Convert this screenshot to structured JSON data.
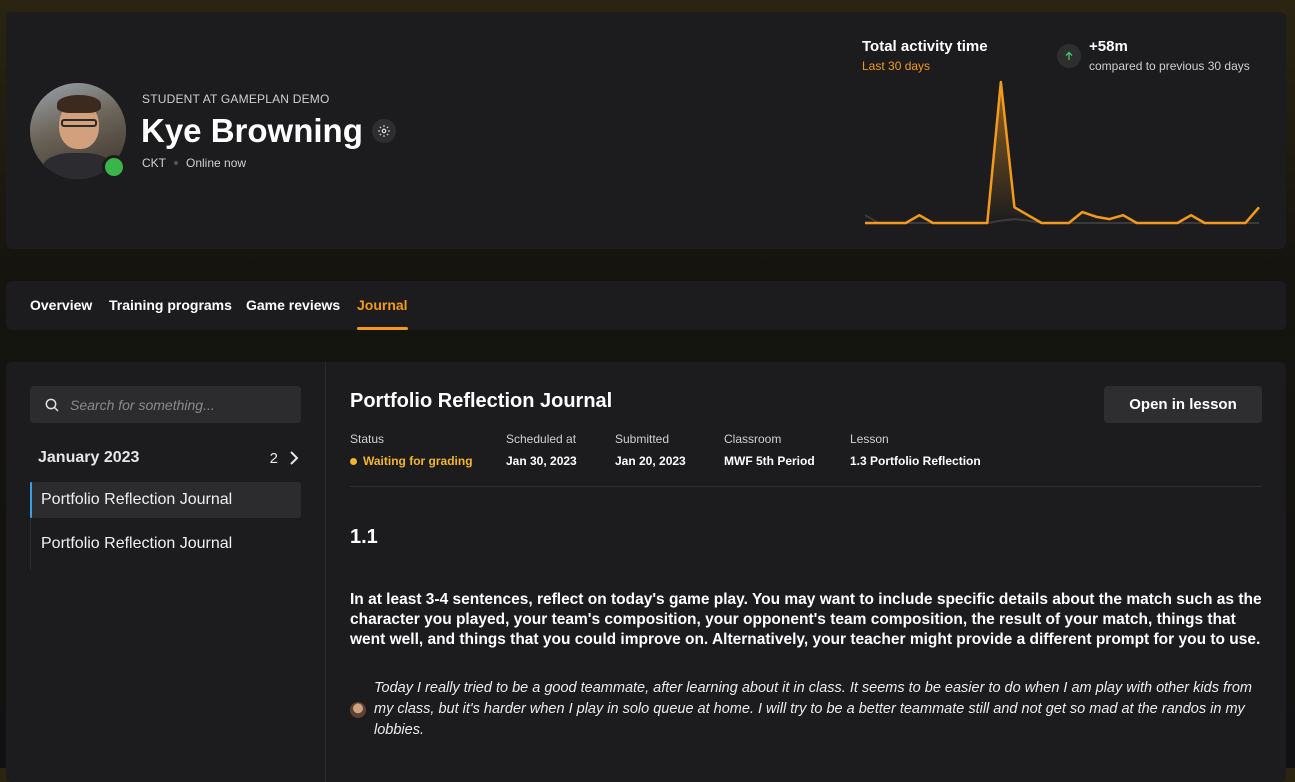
{
  "profile": {
    "role": "STUDENT AT GAMEPLAN DEMO",
    "name": "Kye Browning",
    "team": "CKT",
    "status": "Online now"
  },
  "activity": {
    "title": "Total activity time",
    "period": "Last 30 days",
    "delta": "+58m",
    "delta_caption": "compared to previous 30 days"
  },
  "chart_data": {
    "type": "area",
    "x": [
      1,
      2,
      3,
      4,
      5,
      6,
      7,
      8,
      9,
      10,
      11,
      12,
      13,
      14,
      15,
      16,
      17,
      18,
      19,
      20,
      21,
      22,
      23,
      24,
      25,
      26,
      27,
      28,
      29,
      30
    ],
    "series": [
      {
        "values": [
          0,
          0,
          0,
          0,
          1,
          0,
          0,
          0,
          0,
          0,
          18,
          2,
          1,
          0,
          0,
          0,
          1.4,
          0.8,
          0.5,
          1,
          0,
          0,
          0,
          0,
          1,
          0,
          0,
          0,
          0,
          2
        ]
      },
      {
        "values": [
          1,
          0,
          0,
          0,
          0,
          0,
          0,
          0,
          0,
          0,
          0.3,
          0.5,
          0.3,
          0,
          0,
          0,
          0,
          0,
          0,
          0,
          0,
          0,
          0,
          0,
          0,
          0,
          0,
          0,
          0,
          0
        ]
      }
    ],
    "colors": [
      "#f39a1d",
      "#3a3a3a"
    ]
  },
  "tabs": [
    {
      "label": "Overview"
    },
    {
      "label": "Training programs"
    },
    {
      "label": "Game reviews"
    },
    {
      "label": "Journal",
      "active": true
    }
  ],
  "sidebar": {
    "search_placeholder": "Search for something...",
    "month": "January 2023",
    "count": "2",
    "entries": [
      "Portfolio Reflection Journal",
      "Portfolio Reflection Journal"
    ]
  },
  "journal": {
    "title": "Portfolio Reflection Journal",
    "open_button": "Open in lesson",
    "meta": {
      "status_label": "Status",
      "status_value": "Waiting for grading",
      "scheduled_label": "Scheduled at",
      "scheduled_value": "Jan 30, 2023",
      "submitted_label": "Submitted",
      "submitted_value": "Jan 20, 2023",
      "classroom_label": "Classroom",
      "classroom_value": "MWF 5th Period",
      "lesson_label": "Lesson",
      "lesson_value": "1.3 Portfolio Reflection"
    },
    "section": "1.1",
    "prompt": "In at least 3-4 sentences, reflect on today's game play. You may want to include specific details about the match such as the character you played, your team's composition, your opponent's team composition, the result of your match, things that went well, and things that you could improve on. Alternatively, your teacher might provide a different prompt for you to use.",
    "answer": "Today I really tried to be a good teammate, after learning about it in class. It seems to be easier to do when I am play with other kids from my class, but it's harder when I play in solo queue at home. I will try to be a better teammate still and not get so mad at the randos in my lobbies."
  }
}
